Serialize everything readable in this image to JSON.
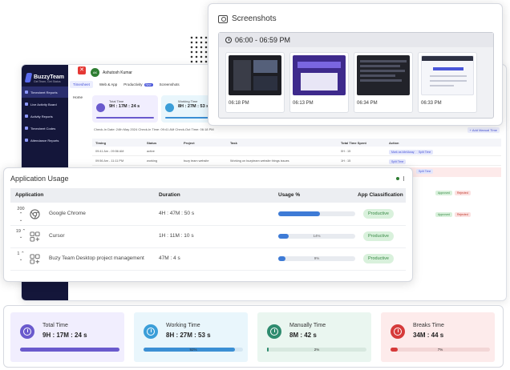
{
  "app": {
    "logo": {
      "name": "BuzzyTeam",
      "tagline": "Get Team, Get Status"
    },
    "close_glyph": "✕",
    "user": {
      "initials": "AK",
      "name": "Ashutosh Kumar"
    },
    "sidebar": [
      {
        "label": "Timesheet Reports"
      },
      {
        "label": "Live Activity Board"
      },
      {
        "label": "Activity Reports"
      },
      {
        "label": "Timesheet Codes"
      },
      {
        "label": "Attendance Reports"
      }
    ],
    "tabs": [
      {
        "label": "Timesheet"
      },
      {
        "label": "Web & App"
      },
      {
        "label": "Productivity",
        "badge": "New"
      },
      {
        "label": "Screenshots"
      }
    ],
    "home_label": "Home",
    "mini_cards": [
      {
        "title": "Total Time",
        "value": "9H : 17M : 24 s"
      },
      {
        "title": "Working Time",
        "value": "8H : 27M : 53 s"
      }
    ],
    "checkin": "Check-In Date: 24th May 2024   Check-In Time: 09:41 AM   Check-Out Time: 06:18 PM",
    "add_manual": "+ Add Manual Time",
    "table": {
      "headers": [
        "Timing",
        "Status",
        "Project",
        "Task",
        "Total Time Spent",
        "Action"
      ],
      "rows": [
        {
          "timing": "09:41 Am - 09:56 AM",
          "status": "active",
          "project": "",
          "task": "",
          "total": "0H : 15",
          "actions": [
            "Mark as Idle/Away",
            "Split Time"
          ]
        },
        {
          "timing": "09:56 Am - 11:11 PM",
          "status": "working",
          "project": "buzy team website",
          "task": "Working on buzyteam website things issues",
          "total": "1H : 15",
          "actions": [
            "Split Time"
          ]
        }
      ]
    },
    "side_actions": {
      "split": "Split Time",
      "approved": "Approved",
      "rejected": "Rejected"
    }
  },
  "screenshots": {
    "title": "Screenshots",
    "range": "06:00 - 06:59 PM",
    "items": [
      {
        "time": "06:18 PM"
      },
      {
        "time": "06:13 PM"
      },
      {
        "time": "06:34 PM"
      },
      {
        "time": "06:33 PM"
      }
    ]
  },
  "usage": {
    "title": "Application Usage",
    "headers": {
      "application": "Application",
      "duration": "Duration",
      "usage": "Usage %",
      "classification": "App Classification"
    },
    "rows": [
      {
        "rank": "200",
        "name": "Google Chrome",
        "icon": "chrome-icon",
        "duration": "4H : 47M : 50 s",
        "usage": 54,
        "usage_label": "",
        "classification": "Productive"
      },
      {
        "rank": "19",
        "name": "Cursor",
        "icon": "app-grid-icon",
        "duration": "1H : 11M : 10 s",
        "usage": 14,
        "usage_label": "14%",
        "classification": "Productive"
      },
      {
        "rank": "1",
        "name": "Buzy Team Desktop project management",
        "icon": "app-grid-icon",
        "duration": "47M : 4 s",
        "usage": 9,
        "usage_label": "9%",
        "classification": "Productive"
      }
    ]
  },
  "stats": [
    {
      "title": "Total Time",
      "value": "9H : 17M : 24 s",
      "percent": 100,
      "percent_label": "",
      "color": "#6a5acd",
      "bg": "#f1eefe",
      "icon_color": "#6a5acd",
      "track": "#dcd6fb",
      "icon": "clock-icon"
    },
    {
      "title": "Working Time",
      "value": "8H : 27M : 53 s",
      "percent": 92,
      "percent_label": "92%",
      "color": "#3b8fd4",
      "bg": "#e9f6fc",
      "icon_color": "#3b9ed8",
      "track": "#d4e6f2",
      "icon": "clock-icon"
    },
    {
      "title": "Manually Time",
      "value": "8M : 42 s",
      "percent": 2,
      "percent_label": "2%",
      "color": "#2e8b6e",
      "bg": "#eaf6f0",
      "icon_color": "#2e8b6e",
      "track": "#d7e8df",
      "icon": "clock-icon"
    },
    {
      "title": "Breaks Time",
      "value": "34M : 44 s",
      "percent": 7,
      "percent_label": "7%",
      "color": "#d63a3a",
      "bg": "#fdebeb",
      "icon_color": "#d63a3a",
      "track": "#f3d6d6",
      "icon": "clock-icon"
    }
  ]
}
